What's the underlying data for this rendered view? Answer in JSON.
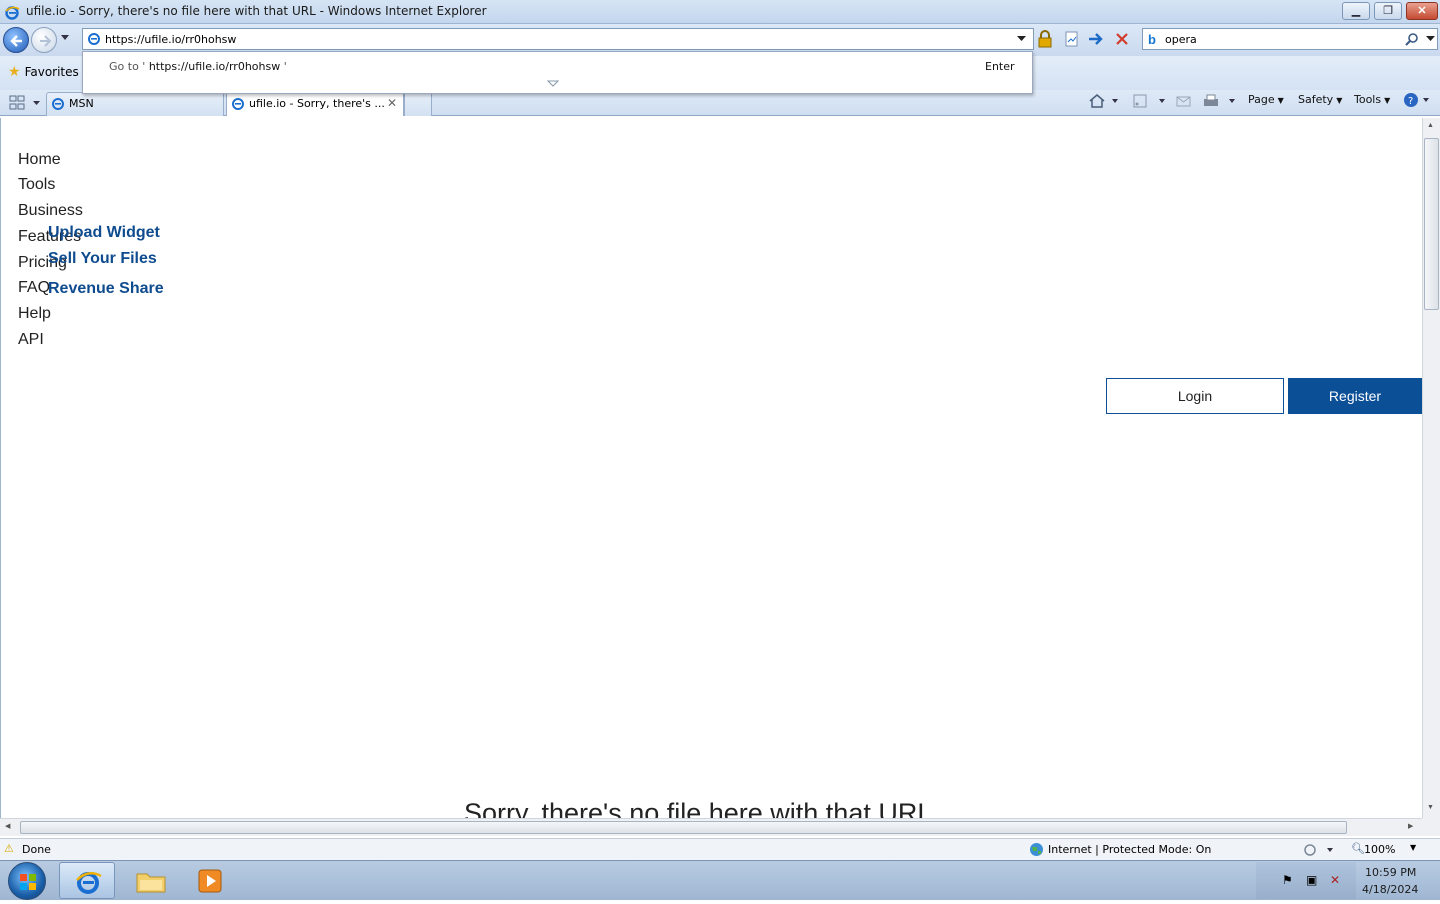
{
  "window": {
    "title": "ufile.io - Sorry, there's no file here with that URL - Windows Internet Explorer"
  },
  "addressbar": {
    "url": "https://ufile.io/rr0hohsw",
    "autocomplete_prefix": "Go to '",
    "autocomplete_url": "https://ufile.io/rr0hohsw",
    "autocomplete_suffix": "'",
    "autocomplete_enter": "Enter"
  },
  "search": {
    "value": "opera",
    "provider_icon": "bing-icon"
  },
  "favorites": {
    "label": "Favorites"
  },
  "tabs": [
    {
      "label": "MSN",
      "active": false
    },
    {
      "label": "ufile.io - Sorry, there's ...",
      "active": true
    }
  ],
  "commandbar": {
    "page": "Page",
    "safety": "Safety",
    "tools": "Tools"
  },
  "site": {
    "nav": [
      "Home",
      "Tools",
      "Business",
      "Features",
      "Pricing",
      "FAQ",
      "Help",
      "API"
    ],
    "features_menu": [
      "Upload Widget",
      "Sell Your Files",
      "Revenue Share"
    ],
    "login": "Login",
    "register": "Register",
    "heading": "Sorry, there's no file here with that URL",
    "accent_color": "#0b4f97"
  },
  "statusbar": {
    "status": "Done",
    "zone": "Internet | Protected Mode: On",
    "zoom": "100%"
  },
  "taskbar": {
    "time": "10:59 PM",
    "date": "4/18/2024"
  }
}
